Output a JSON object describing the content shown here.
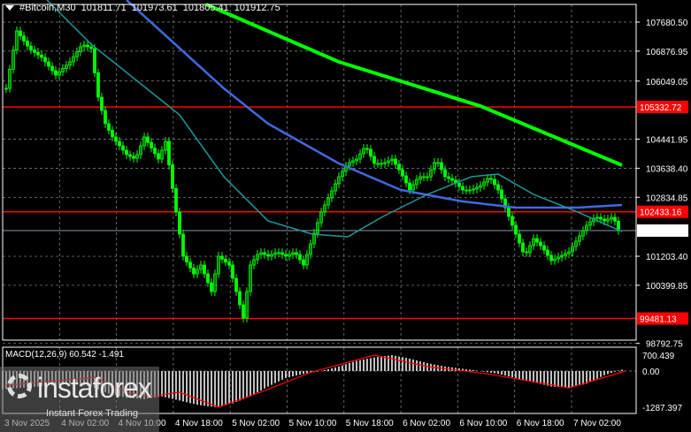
{
  "header": {
    "symbol": "#Bitcoin,M30",
    "open": "101811.71",
    "high": "101973.61",
    "low": "101805.41",
    "close": "101912.75"
  },
  "macd_label": "MACD(12,26,9) 60.542 -1.491",
  "watermark": {
    "brand": "instaforex",
    "tagline": "Instant Forex Trading"
  },
  "colors": {
    "bull": "#00ff00",
    "level": "#ff0000",
    "ma_slow": "#00ff00",
    "ma_mid": "#4169e1",
    "ma_fast": "#1a9a9a",
    "macd_hist": "#c0c0c0",
    "macd_signal": "#ff0000",
    "grid": "#8a8a99"
  },
  "chart_data": {
    "type": "candlestick",
    "price_axis": {
      "ticks": [
        "107680.50",
        "106876.95",
        "106049.05",
        "104441.95",
        "103638.40",
        "102834.85",
        "101203.40",
        "100399.85",
        "98792.75"
      ],
      "range": [
        98792.75,
        107680.5
      ]
    },
    "time_axis": {
      "ticks": [
        "3 Nov 2025",
        "4 Nov 02:00",
        "4 Nov 10:00",
        "4 Nov 18:00",
        "5 Nov 02:00",
        "5 Nov 10:00",
        "5 Nov 18:00",
        "6 Nov 02:00",
        "6 Nov 10:00",
        "6 Nov 18:00",
        "7 Nov 02:00"
      ]
    },
    "levels": [
      {
        "price": "105332.72"
      },
      {
        "price": "102433.16"
      },
      {
        "price": "99481.13"
      }
    ],
    "current_price": "101912.75",
    "closes": [
      [
        1,
        105847
      ],
      [
        4,
        107436
      ],
      [
        7.5,
        106947
      ],
      [
        11,
        106703
      ],
      [
        15,
        106214
      ],
      [
        19,
        106581
      ],
      [
        22.5,
        107069
      ],
      [
        25,
        106947
      ],
      [
        27,
        105603
      ],
      [
        29,
        104870
      ],
      [
        31,
        104503
      ],
      [
        35,
        104014
      ],
      [
        37.5,
        103892
      ],
      [
        40,
        104503
      ],
      [
        44,
        103892
      ],
      [
        46,
        104381
      ],
      [
        49,
        102426
      ],
      [
        51,
        101204
      ],
      [
        54,
        100715
      ],
      [
        56,
        100960
      ],
      [
        59,
        100227
      ],
      [
        61,
        101204
      ],
      [
        64,
        100960
      ],
      [
        66,
        100227
      ],
      [
        68,
        99494
      ],
      [
        70,
        100960
      ],
      [
        72.5,
        101326
      ],
      [
        75,
        101204
      ],
      [
        77.5,
        101326
      ],
      [
        80,
        101204
      ],
      [
        82.5,
        101326
      ],
      [
        85,
        100960
      ],
      [
        87.5,
        101693
      ],
      [
        90,
        102426
      ],
      [
        92.5,
        102915
      ],
      [
        95,
        103403
      ],
      [
        97.5,
        103770
      ],
      [
        100,
        103892
      ],
      [
        102.5,
        104259
      ],
      [
        105,
        103770
      ],
      [
        107.5,
        103770
      ],
      [
        110,
        103892
      ],
      [
        112.5,
        103526
      ],
      [
        115,
        103037
      ],
      [
        117.5,
        103403
      ],
      [
        120,
        103403
      ],
      [
        122.5,
        103892
      ],
      [
        125,
        103403
      ],
      [
        127.5,
        103281
      ],
      [
        130,
        103037
      ],
      [
        132.5,
        103037
      ],
      [
        135,
        103159
      ],
      [
        137.5,
        103403
      ],
      [
        140,
        103037
      ],
      [
        142.5,
        102426
      ],
      [
        145,
        101815
      ],
      [
        147.5,
        101204
      ],
      [
        150,
        101693
      ],
      [
        152.5,
        101448
      ],
      [
        155,
        101082
      ],
      [
        157.5,
        101204
      ],
      [
        160,
        101326
      ],
      [
        162.5,
        101693
      ],
      [
        165,
        102059
      ],
      [
        167.5,
        102304
      ],
      [
        170,
        102181
      ],
      [
        172.5,
        102304
      ],
      [
        174,
        101913
      ]
    ],
    "moving_averages": [
      {
        "points": [
          [
            57.5,
            108169
          ],
          [
            95,
            106581
          ],
          [
            135,
            105358
          ],
          [
            175,
            103721
          ]
        ]
      },
      {
        "points": [
          [
            35,
            108291
          ],
          [
            62.5,
            105847
          ],
          [
            75,
            104870
          ],
          [
            95,
            103770
          ],
          [
            112.5,
            103037
          ],
          [
            130,
            102719
          ],
          [
            145,
            102548
          ],
          [
            162.5,
            102548
          ],
          [
            175,
            102621
          ]
        ]
      },
      {
        "points": [
          [
            12.5,
            108291
          ],
          [
            25,
            107069
          ],
          [
            37.5,
            106092
          ],
          [
            50,
            105114
          ],
          [
            62.5,
            103403
          ],
          [
            75,
            102181
          ],
          [
            87.5,
            101815
          ],
          [
            97.5,
            101742
          ],
          [
            107.5,
            102304
          ],
          [
            120,
            102915
          ],
          [
            132.5,
            103403
          ],
          [
            140,
            103476
          ],
          [
            150,
            102915
          ],
          [
            162.5,
            102426
          ],
          [
            175,
            101888
          ]
        ]
      }
    ],
    "macd": {
      "params": "12,26,9",
      "ticks": [
        "700.439",
        "0.00",
        "-1287.397"
      ],
      "range": [
        -1287.397,
        700.439
      ],
      "histogram": [
        [
          0,
          -650
        ],
        [
          5,
          -600
        ],
        [
          10,
          -550
        ],
        [
          15,
          -500
        ],
        [
          20,
          -450
        ],
        [
          25,
          -550
        ],
        [
          30,
          -800
        ],
        [
          35,
          -950
        ],
        [
          40,
          -1000
        ],
        [
          45,
          -900
        ],
        [
          50,
          -1050
        ],
        [
          55,
          -1200
        ],
        [
          60,
          -1280
        ],
        [
          65,
          -1150
        ],
        [
          70,
          -900
        ],
        [
          75,
          -550
        ],
        [
          80,
          -250
        ],
        [
          85,
          -100
        ],
        [
          90,
          0
        ],
        [
          95,
          200
        ],
        [
          100,
          450
        ],
        [
          105,
          600
        ],
        [
          110,
          700
        ],
        [
          115,
          550
        ],
        [
          120,
          350
        ],
        [
          125,
          200
        ],
        [
          130,
          100
        ],
        [
          135,
          0
        ],
        [
          140,
          -100
        ],
        [
          145,
          -250
        ],
        [
          150,
          -400
        ],
        [
          155,
          -550
        ],
        [
          160,
          -600
        ],
        [
          165,
          -450
        ],
        [
          170,
          -150
        ],
        [
          175,
          60
        ]
      ],
      "signal": [
        [
          0,
          -520
        ],
        [
          26,
          -220
        ],
        [
          36,
          -800
        ],
        [
          42,
          -900
        ],
        [
          50,
          -750
        ],
        [
          61,
          -1287
        ],
        [
          75,
          -650
        ],
        [
          87,
          -50
        ],
        [
          105,
          700
        ],
        [
          120,
          200
        ],
        [
          137,
          -100
        ],
        [
          160,
          -600
        ],
        [
          176,
          0
        ]
      ]
    }
  }
}
